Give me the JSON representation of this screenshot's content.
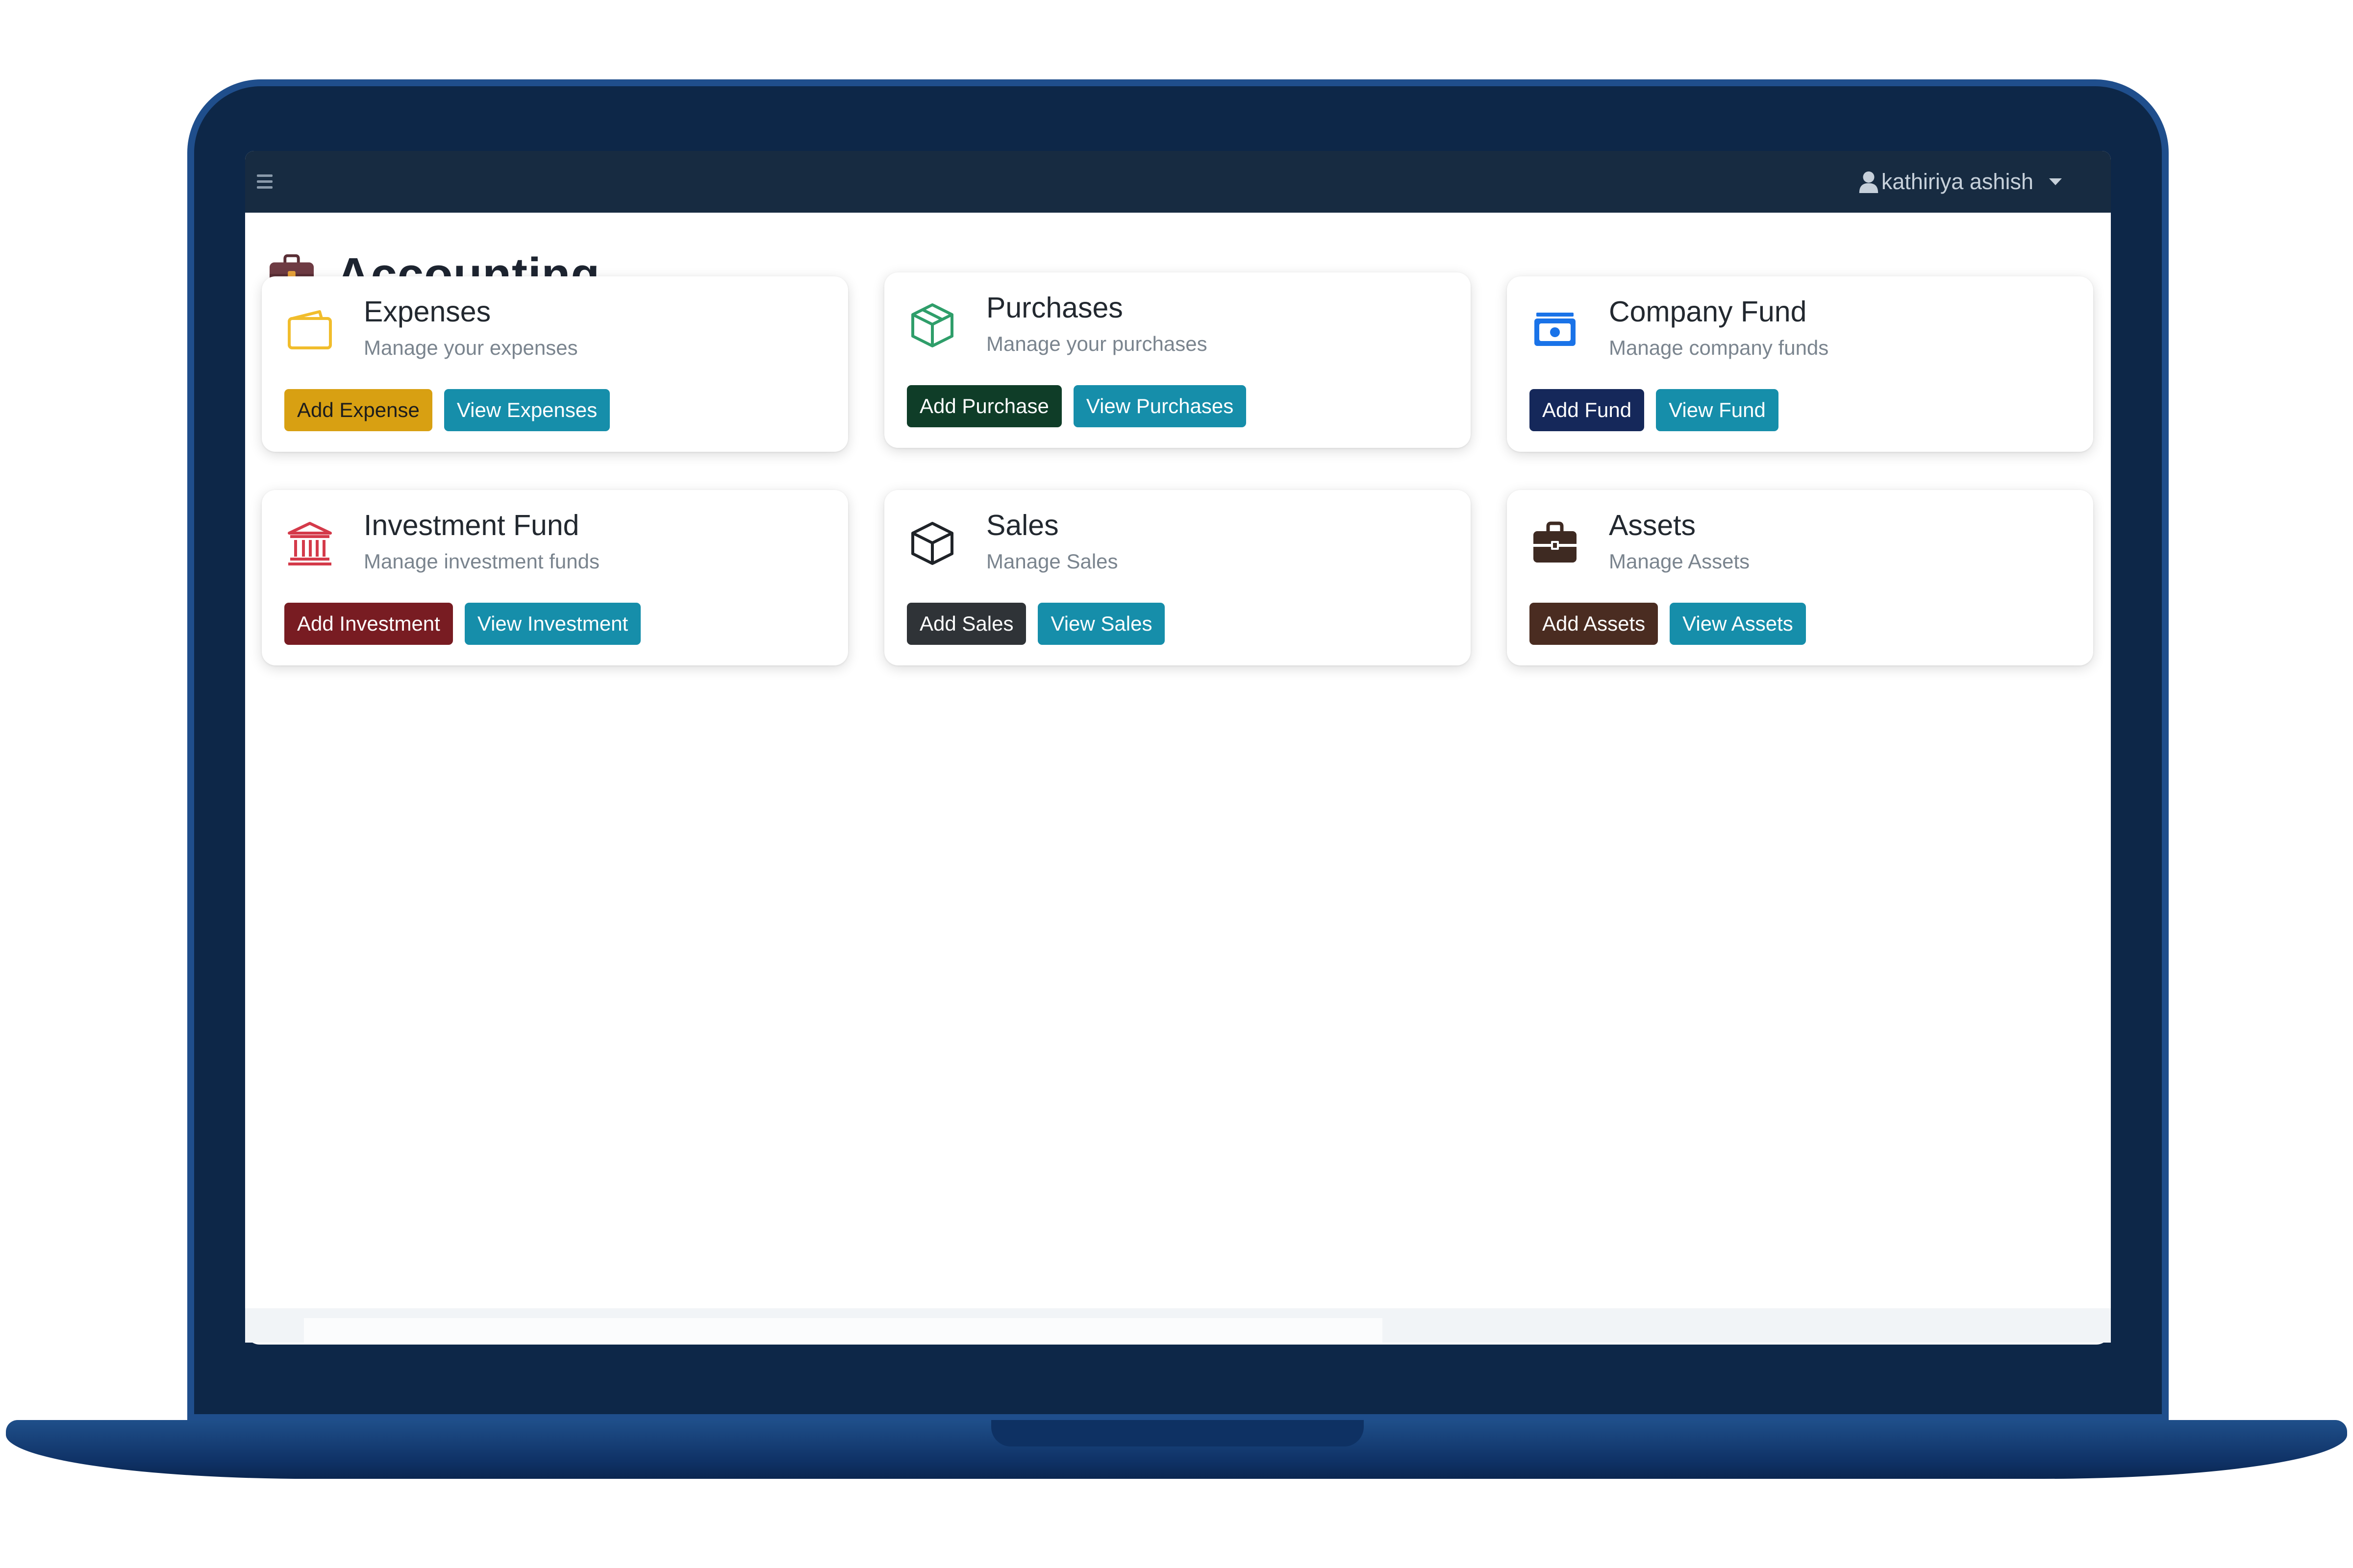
{
  "topbar": {
    "menu_icon": "hamburger-icon",
    "user_icon": "user-icon",
    "user_name": "kathiriya ashish",
    "background": "#172b41"
  },
  "page": {
    "title": "Accounting",
    "title_icon": "briefcase-icon",
    "title_icon_color": "#6e3b43"
  },
  "cards": [
    {
      "title": "Expenses",
      "subtitle": "Manage your expenses",
      "icon": "wallet-icon",
      "icon_color": "#f1bd2c",
      "add_label": "Add Expense",
      "add_color": "#d8a012",
      "add_text_color": "#1d1d1d",
      "view_label": "View Expenses"
    },
    {
      "title": "Purchases",
      "subtitle": "Manage your purchases",
      "icon": "box-icon",
      "icon_color": "#2f9e6a",
      "add_label": "Add Purchase",
      "add_color": "#0f3d28",
      "add_text_color": "#ffffff",
      "view_label": "View Purchases"
    },
    {
      "title": "Company Fund",
      "subtitle": "Manage company funds",
      "icon": "cash-icon",
      "icon_color": "#1a73e8",
      "add_label": "Add Fund",
      "add_color": "#15285a",
      "add_text_color": "#ffffff",
      "view_label": "View Fund"
    },
    {
      "title": "Investment Fund",
      "subtitle": "Manage investment funds",
      "icon": "bank-icon",
      "icon_color": "#d43a4a",
      "add_label": "Add Investment",
      "add_color": "#781c22",
      "add_text_color": "#ffffff",
      "view_label": "View Investment"
    },
    {
      "title": "Sales",
      "subtitle": "Manage Sales",
      "icon": "cube-icon",
      "icon_color": "#1f2328",
      "add_label": "Add Sales",
      "add_color": "#2f3337",
      "add_text_color": "#ffffff",
      "view_label": "View Sales"
    },
    {
      "title": "Assets",
      "subtitle": "Manage Assets",
      "icon": "briefcase-icon",
      "icon_color": "#3e2a22",
      "add_label": "Add Assets",
      "add_color": "#4a2c21",
      "add_text_color": "#ffffff",
      "view_label": "View Assets"
    }
  ],
  "colors": {
    "view_button": "#168eaa",
    "laptop_frame": "#1f4e8c",
    "laptop_bezel": "#0d2748"
  }
}
